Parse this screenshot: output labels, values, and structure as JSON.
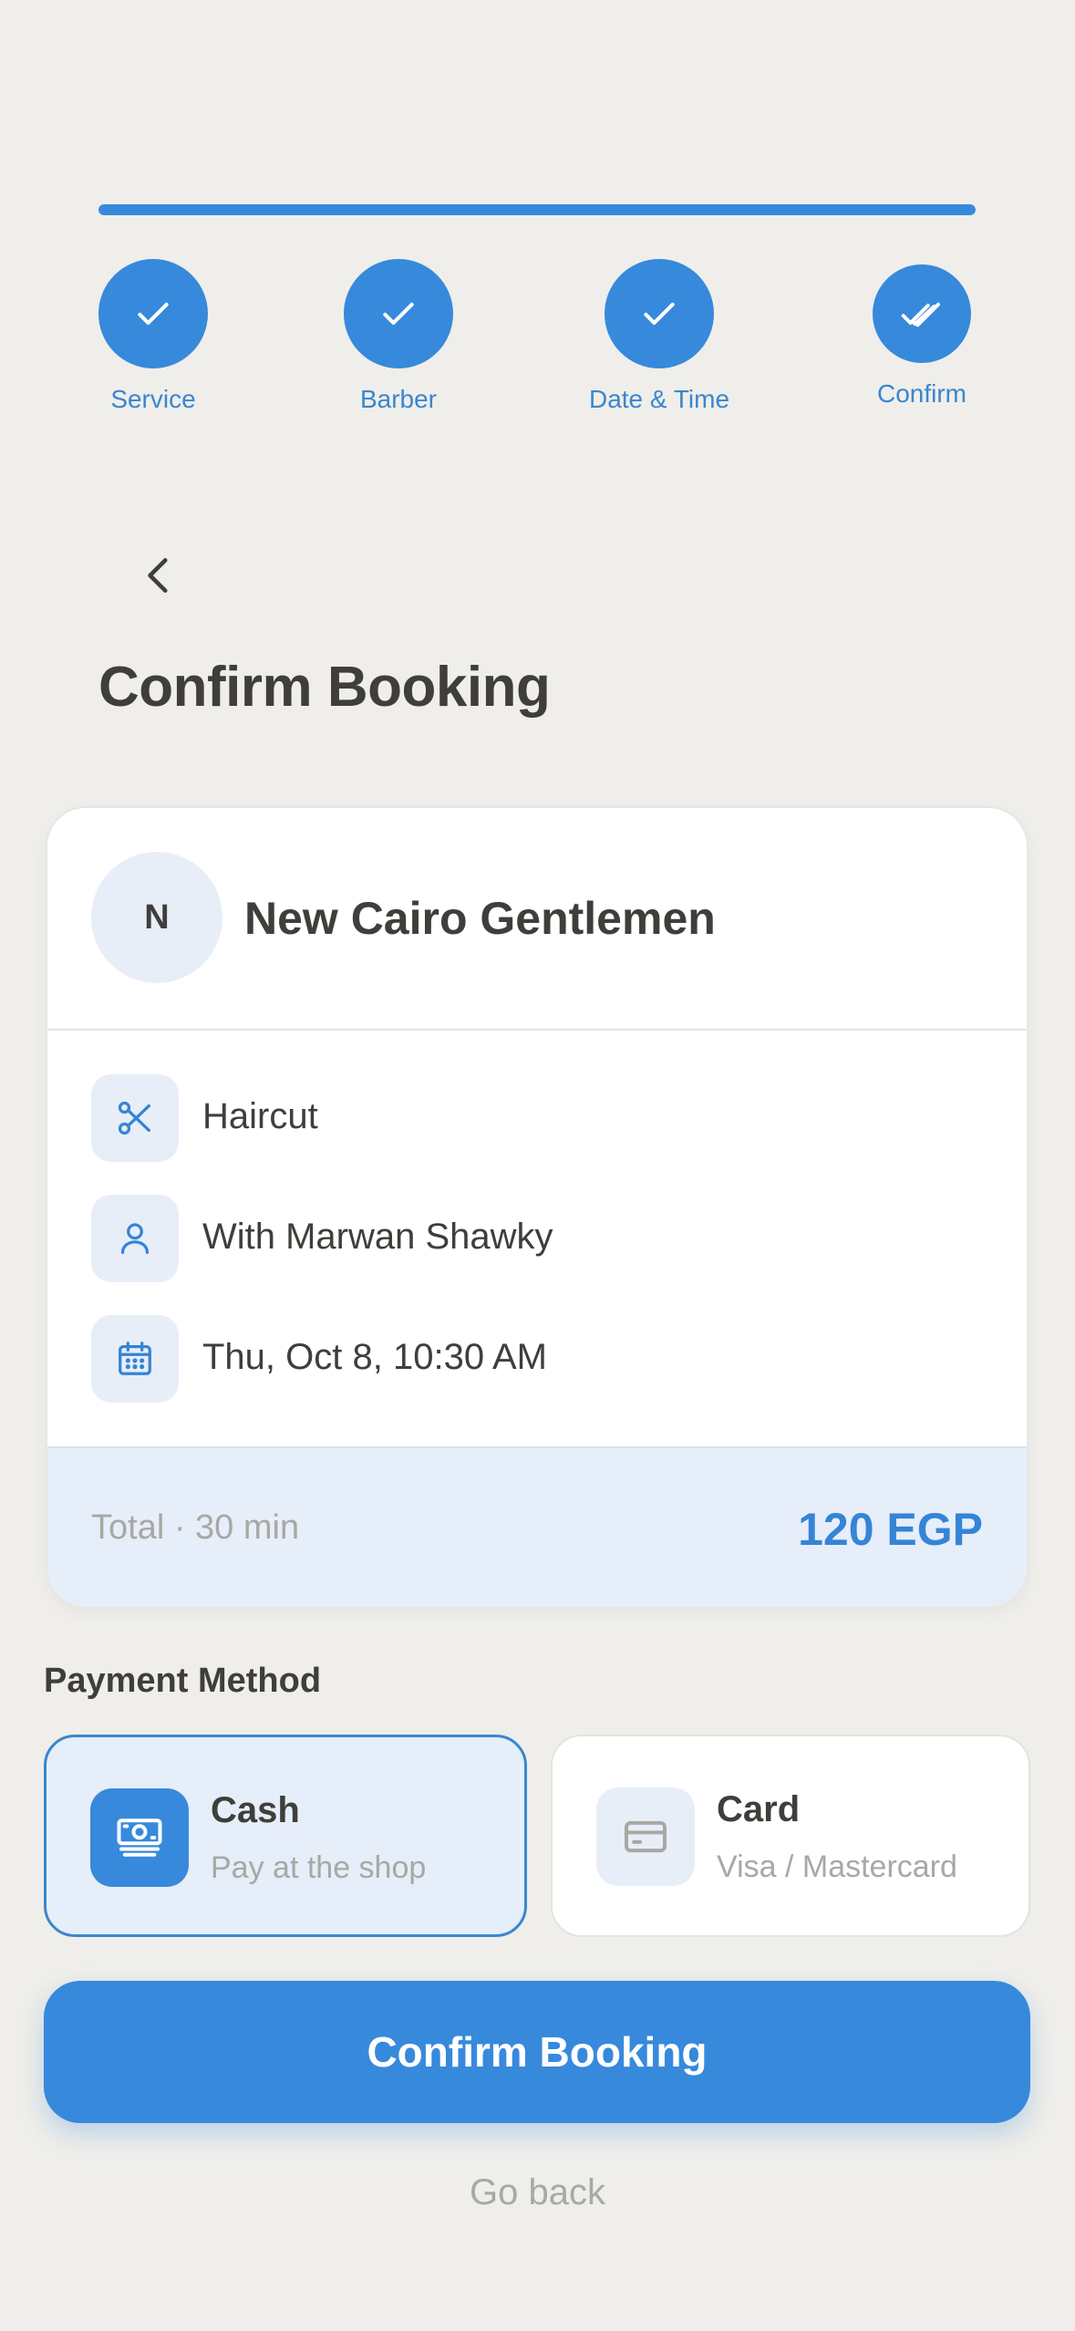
{
  "progress": {
    "value": 1.0
  },
  "steps": [
    {
      "label": "Service",
      "icon": "check-icon",
      "status": "done"
    },
    {
      "label": "Barber",
      "icon": "check-icon",
      "status": "done"
    },
    {
      "label": "Date & Time",
      "icon": "check-icon",
      "status": "done"
    },
    {
      "label": "Confirm",
      "icon": "double-check-icon",
      "status": "current"
    }
  ],
  "header": {
    "back_icon": "chevron-left-icon",
    "title": "Confirm Booking"
  },
  "summary": {
    "shop_initial": "N",
    "shop_name": "New Cairo Gentlemen",
    "service": {
      "icon": "scissors-icon",
      "text": "Haircut"
    },
    "barber": {
      "icon": "user-icon",
      "text": "With Marwan Shawky"
    },
    "datetime": {
      "icon": "calendar-icon",
      "text": "Thu, Oct 8, 10:30 AM"
    },
    "total_label": "Total · 30 min",
    "total_price": "120 EGP"
  },
  "payment": {
    "title": "Payment Method",
    "options": [
      {
        "name": "Cash",
        "subtitle": "Pay at the shop",
        "icon": "banknote-icon",
        "selected": true
      },
      {
        "name": "Card",
        "subtitle": "Visa / Mastercard",
        "icon": "credit-card-icon",
        "selected": false
      }
    ]
  },
  "actions": {
    "confirm_label": "Confirm Booking",
    "go_back_label": "Go back"
  },
  "colors": {
    "accent": "#3789dc",
    "background": "#efeeea",
    "tint": "#e6eef9",
    "text": "#3f3e3a",
    "muted": "#a8a8a4"
  }
}
